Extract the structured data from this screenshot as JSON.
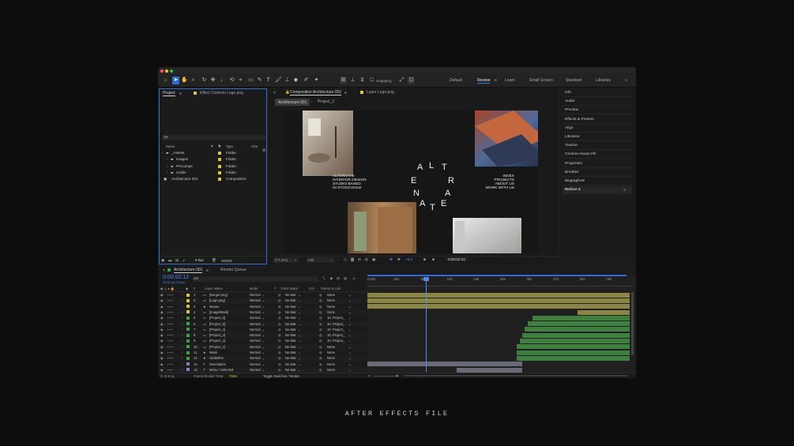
{
  "caption": "AFTER EFFECTS FILE",
  "colors": {
    "accent": "#2d7bf0",
    "timecode": "#4f8df5",
    "yellow_label": "#d6c640",
    "green_label": "#3aa34a",
    "purple_label": "#8c7fc8",
    "track_khaki": "#8a8540",
    "track_green": "#3f7f40",
    "track_gray": "#6b6b77"
  },
  "toolbar": {
    "snapping": "Snapping",
    "workspaces": [
      "Default",
      "Review",
      "Learn",
      "Small Screen",
      "Standard",
      "Libraries"
    ],
    "active_workspace": "Review",
    "more": "»"
  },
  "project_panel": {
    "tabs": [
      "Project",
      "Effect Controls Logo.png"
    ],
    "search_placeholder": "Q▾",
    "columns": {
      "name": "Name",
      "type": "Type",
      "size": "Size"
    },
    "items": [
      {
        "name": "_Assets",
        "type": "Folder",
        "indent": 0
      },
      {
        "name": "Images",
        "type": "Folder",
        "indent": 1
      },
      {
        "name": "Precomps",
        "type": "Folder",
        "indent": 1
      },
      {
        "name": "Solids",
        "type": "Folder",
        "indent": 1
      },
      {
        "name": "Architecture 001",
        "type": "Composition",
        "indent": 0
      }
    ],
    "bpc": "8 bpc"
  },
  "comp_panel": {
    "tabs": [
      "Composition Architecture 001",
      "Layer Logo.png"
    ],
    "breadcrumbs": [
      "Architecture 001",
      "Project_2"
    ],
    "zoom": "(77,4%)",
    "resolution": "Full",
    "exposure": "+0,0",
    "timecode": "0:00:02:12",
    "artwork": {
      "logo_letters": [
        "A",
        "L",
        "T",
        "E",
        "R",
        "N",
        "A",
        "T",
        "E"
      ],
      "left_text": [
        "ALTERNATE",
        "INTERIOR DESIGN",
        "STUDIO BASED",
        "IN STOCKHOLM"
      ],
      "right_text": [
        "INDEX",
        "PROJECTS",
        "ABOUT US",
        "WORK WITH US"
      ]
    }
  },
  "right_panel": {
    "items": [
      "Info",
      "Audio",
      "Preview",
      "Effects & Presets",
      "Align",
      "Libraries",
      "Tracker",
      "Content-Aware Fill",
      "Properties",
      "Brushes",
      "MographAE",
      "Motion 4"
    ]
  },
  "timeline": {
    "tabs": [
      "Architecture 001",
      "Render Queue"
    ],
    "timecode": "0:00:02:12",
    "timecode_sub": "00132 (60.00 fps)",
    "search_placeholder": "Q▾",
    "columns": {
      "layer_name": "Layer Name",
      "mode": "Mode",
      "t": "T",
      "track_matte": "Track Matte",
      "parent": "Parent & Link"
    },
    "ruler": [
      "0:00s",
      "01s",
      "02s",
      "03s",
      "04s",
      "05s",
      "06s",
      "07s",
      "08s",
      "09s"
    ],
    "layers": [
      {
        "n": "1",
        "name": "[Burger.png]",
        "icon": "img",
        "label": "yellow",
        "mode": "Normal",
        "matte": "No Mat",
        "parent": "None"
      },
      {
        "n": "2",
        "name": "[Logo.png]",
        "icon": "img",
        "label": "yellow",
        "mode": "Normal",
        "matte": "No Mat",
        "parent": "None"
      },
      {
        "n": "3",
        "name": "Mouse",
        "icon": "star",
        "label": "yellow",
        "mode": "Normal",
        "matte": "No Mat",
        "parent": "None"
      },
      {
        "n": "4",
        "name": "[ImageMask]",
        "icon": "img",
        "label": "yellow",
        "mode": "Normal",
        "matte": "No Mat",
        "parent": "None"
      },
      {
        "n": "5",
        "name": "[Project_6]",
        "icon": "img",
        "label": "green",
        "mode": "Normal",
        "matte": "No Mat",
        "parent": "10. Project_"
      },
      {
        "n": "6",
        "name": "[Project_5]",
        "icon": "img",
        "label": "green",
        "mode": "Normal",
        "matte": "No Mat",
        "parent": "10. Project_"
      },
      {
        "n": "7",
        "name": "[Project_4]",
        "icon": "img",
        "label": "green",
        "mode": "Normal",
        "matte": "No Mat",
        "parent": "10. Project_"
      },
      {
        "n": "8",
        "name": "[Project_3]",
        "icon": "img",
        "label": "green",
        "mode": "Normal",
        "matte": "No Mat",
        "parent": "10. Project_"
      },
      {
        "n": "9",
        "name": "[Project_2]",
        "icon": "img",
        "label": "green",
        "mode": "Normal",
        "matte": "No Mat",
        "parent": "10. Project_"
      },
      {
        "n": "10",
        "name": "[Project_1]",
        "icon": "img",
        "label": "green",
        "mode": "Normal",
        "matte": "No Mat",
        "parent": "None"
      },
      {
        "n": "11",
        "name": "Mask",
        "icon": "star",
        "label": "green",
        "mode": "Normal",
        "matte": "No Mat",
        "parent": "None"
      },
      {
        "n": "12",
        "name": "Underline",
        "icon": "star",
        "label": "green",
        "mode": "Normal",
        "matte": "No Mat",
        "parent": "None"
      },
      {
        "n": "13",
        "name": "Description",
        "icon": "T",
        "label": "purple",
        "mode": "Normal",
        "matte": "No Mat",
        "parent": "None"
      },
      {
        "n": "14",
        "name": "Menu / Selected",
        "icon": "T",
        "label": "purple",
        "mode": "Normal",
        "matte": "No Mat",
        "parent": "None"
      }
    ],
    "footer": {
      "frame_render_label": "Frame Render Time:",
      "frame_render_value": "79ms",
      "toggle": "Toggle Switches / Modes"
    }
  }
}
